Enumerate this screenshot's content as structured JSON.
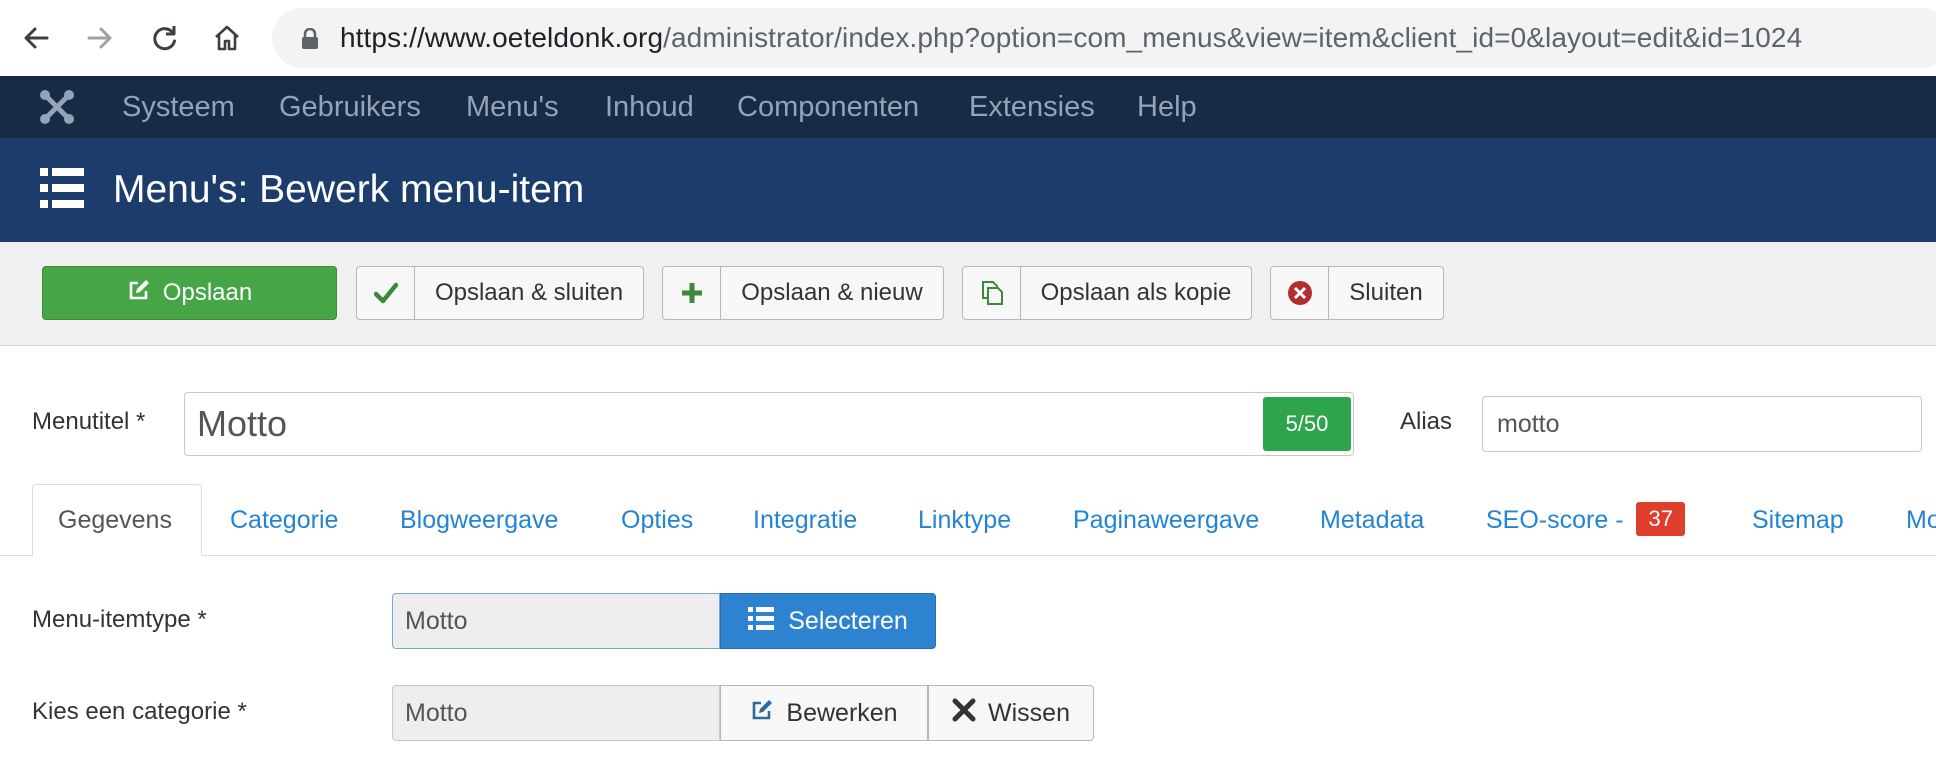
{
  "browser": {
    "url_host": "https://www.oeteldonk.org",
    "url_path": "/administrator/index.php?option=com_menus&view=item&client_id=0&layout=edit&id=1024"
  },
  "admin_menu": {
    "items": [
      "Systeem",
      "Gebruikers",
      "Menu's",
      "Inhoud",
      "Componenten",
      "Extensies",
      "Help"
    ]
  },
  "page": {
    "title": "Menu's: Bewerk menu-item"
  },
  "toolbar": {
    "save_label": "Opslaan",
    "save_close_label": "Opslaan & sluiten",
    "save_new_label": "Opslaan & nieuw",
    "save_copy_label": "Opslaan als kopie",
    "close_label": "Sluiten"
  },
  "form": {
    "menutitle_label": "Menutitel *",
    "menutitle_value": "Motto",
    "menutitle_counter": "5/50",
    "alias_label": "Alias",
    "alias_value": "motto",
    "menutype_label": "Menu-itemtype *",
    "menutype_value": "Motto",
    "select_label": "Selecteren",
    "category_label": "Kies een categorie *",
    "category_value": "Motto",
    "edit_label": "Bewerken",
    "clear_label": "Wissen"
  },
  "tabs": [
    {
      "label": "Gegevens"
    },
    {
      "label": "Categorie"
    },
    {
      "label": "Blogweergave"
    },
    {
      "label": "Opties"
    },
    {
      "label": "Integratie"
    },
    {
      "label": "Linktype"
    },
    {
      "label": "Paginaweergave"
    },
    {
      "label": "Metadata"
    },
    {
      "label": "SEO-score -",
      "badge": "37"
    },
    {
      "label": "Sitemap"
    },
    {
      "label": "Mo"
    }
  ],
  "colors": {
    "admin_menu_bg": "#172a46",
    "title_bar_bg": "#1c3d6c",
    "save_green": "#46a546",
    "counter_green": "#2ea44f",
    "select_blue": "#2e83d0",
    "badge_red": "#e03e2d",
    "link_blue": "#2384d3"
  },
  "icons": [
    "back-arrow-icon",
    "forward-arrow-icon",
    "reload-icon",
    "home-icon",
    "lock-icon",
    "joomla-icon",
    "list-icon",
    "edit-icon",
    "check-icon",
    "plus-icon",
    "copy-icon",
    "close-circle-icon",
    "x-icon"
  ]
}
